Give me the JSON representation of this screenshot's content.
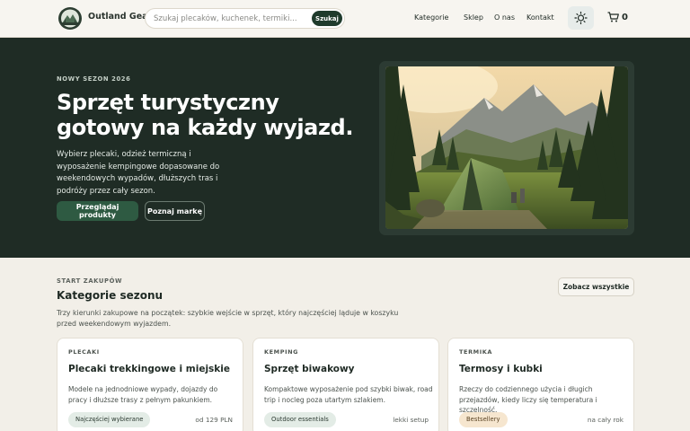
{
  "header": {
    "brand": "Outland Gear",
    "search_placeholder": "Szukaj plecaków, kuchenek, termiki...",
    "search_button": "Szukaj",
    "nav": [
      "Kategorie",
      "Sklep",
      "O nas",
      "Kontakt"
    ],
    "cart_count": "0",
    "icons": {
      "theme": "sun-icon",
      "cart": "cart-icon",
      "logo": "mountain-logo-icon"
    }
  },
  "hero": {
    "eyebrow": "NOWY SEZON 2026",
    "title": "Sprzęt turystyczny gotowy na każdy wyjazd.",
    "description": "Wybierz plecaki, odzież termiczną i wyposażenie kempingowe dopasowane do weekendowych wypadów, dłuższych tras i podróży przez cały sezon.",
    "primary_button": "Przeglądaj produkty",
    "secondary_button": "Poznaj markę"
  },
  "categories": {
    "eyebrow": "START ZAKUPÓW",
    "title": "Kategorie sezonu",
    "description": "Trzy kierunki zakupowe na początek: szybkie wejście w sprzęt, który najczęściej ląduje w koszyku przed weekendowym wyjazdem.",
    "see_all": "Zobacz wszystkie",
    "cards": [
      {
        "tag": "PLECAKI",
        "title": "Plecaki trekkingowe i miejskie",
        "desc": "Modele na jednodniowe wypady, dojazdy do pracy i dłuższe trasy z pełnym pakunkiem.",
        "badge": "Najczęściej wybierane",
        "meta": "od 129 PLN"
      },
      {
        "tag": "KEMPING",
        "title": "Sprzęt biwakowy",
        "desc": "Kompaktowe wyposażenie pod szybki biwak, road trip i nocleg poza utartym szlakiem.",
        "badge": "Outdoor essentials",
        "meta": "lekki setup"
      },
      {
        "tag": "TERMIKA",
        "title": "Termosy i kubki",
        "desc": "Rzeczy do codziennego użycia i długich przejazdów, kiedy liczy się temperatura i szczelność.",
        "badge": "Bestsellery",
        "meta": "na cały rok"
      }
    ]
  },
  "colors": {
    "hero_bg": "#1f2c25",
    "accent": "#2e5a42",
    "page_bg": "#f2efe8"
  }
}
